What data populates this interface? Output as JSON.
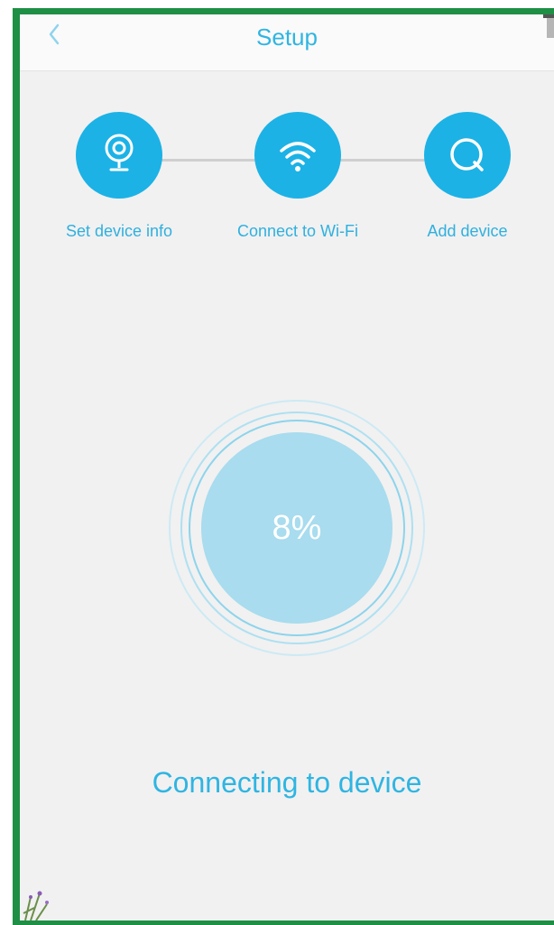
{
  "header": {
    "title": "Setup",
    "back_icon": "chevron-left-icon"
  },
  "steps": [
    {
      "label": "Set device info",
      "icon": "camera-icon"
    },
    {
      "label": "Connect to Wi-Fi",
      "icon": "wifi-icon"
    },
    {
      "label": "Add device",
      "icon": "search-icon"
    }
  ],
  "progress": {
    "value": 8,
    "text": "8%"
  },
  "status": {
    "text": "Connecting to device"
  },
  "colors": {
    "accent": "#1cb2e6",
    "text_accent": "#2fb5e2",
    "progress_fill": "#a8dcee",
    "frame": "#1e8f45",
    "background": "#f1f1f1"
  }
}
